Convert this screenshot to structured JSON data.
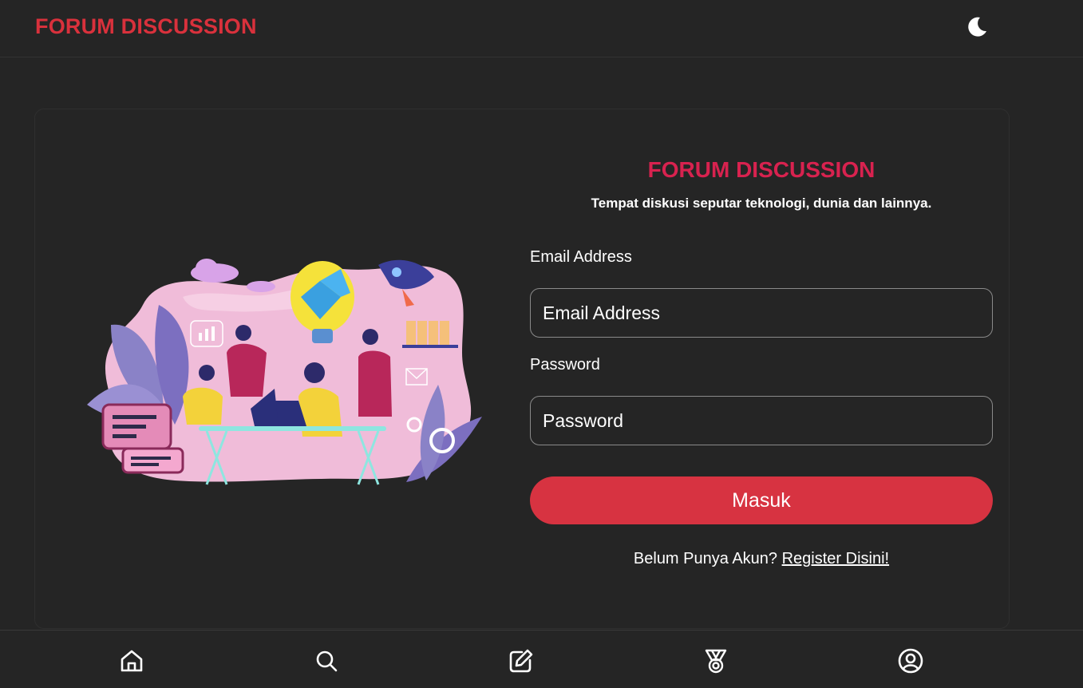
{
  "header": {
    "brand": "FORUM DISCUSSION",
    "theme_icon": "moon-icon"
  },
  "login": {
    "title": "FORUM DISCUSSION",
    "subtitle": "Tempat diskusi seputar teknologi, dunia dan lainnya.",
    "email_label": "Email Address",
    "email_placeholder": "Email Address",
    "email_value": "",
    "password_label": "Password",
    "password_placeholder": "Password",
    "password_value": "",
    "submit_label": "Masuk",
    "register_prompt": "Belum Punya Akun?",
    "register_link": "Register Disini!"
  },
  "bottom_nav": {
    "items": [
      {
        "icon": "home-icon"
      },
      {
        "icon": "search-icon"
      },
      {
        "icon": "edit-icon"
      },
      {
        "icon": "medal-icon"
      },
      {
        "icon": "user-circle-icon"
      }
    ]
  },
  "colors": {
    "background": "#252525",
    "brand": "#d9313c",
    "title": "#d8224f",
    "button": "#d73341",
    "text": "#ffffff"
  }
}
